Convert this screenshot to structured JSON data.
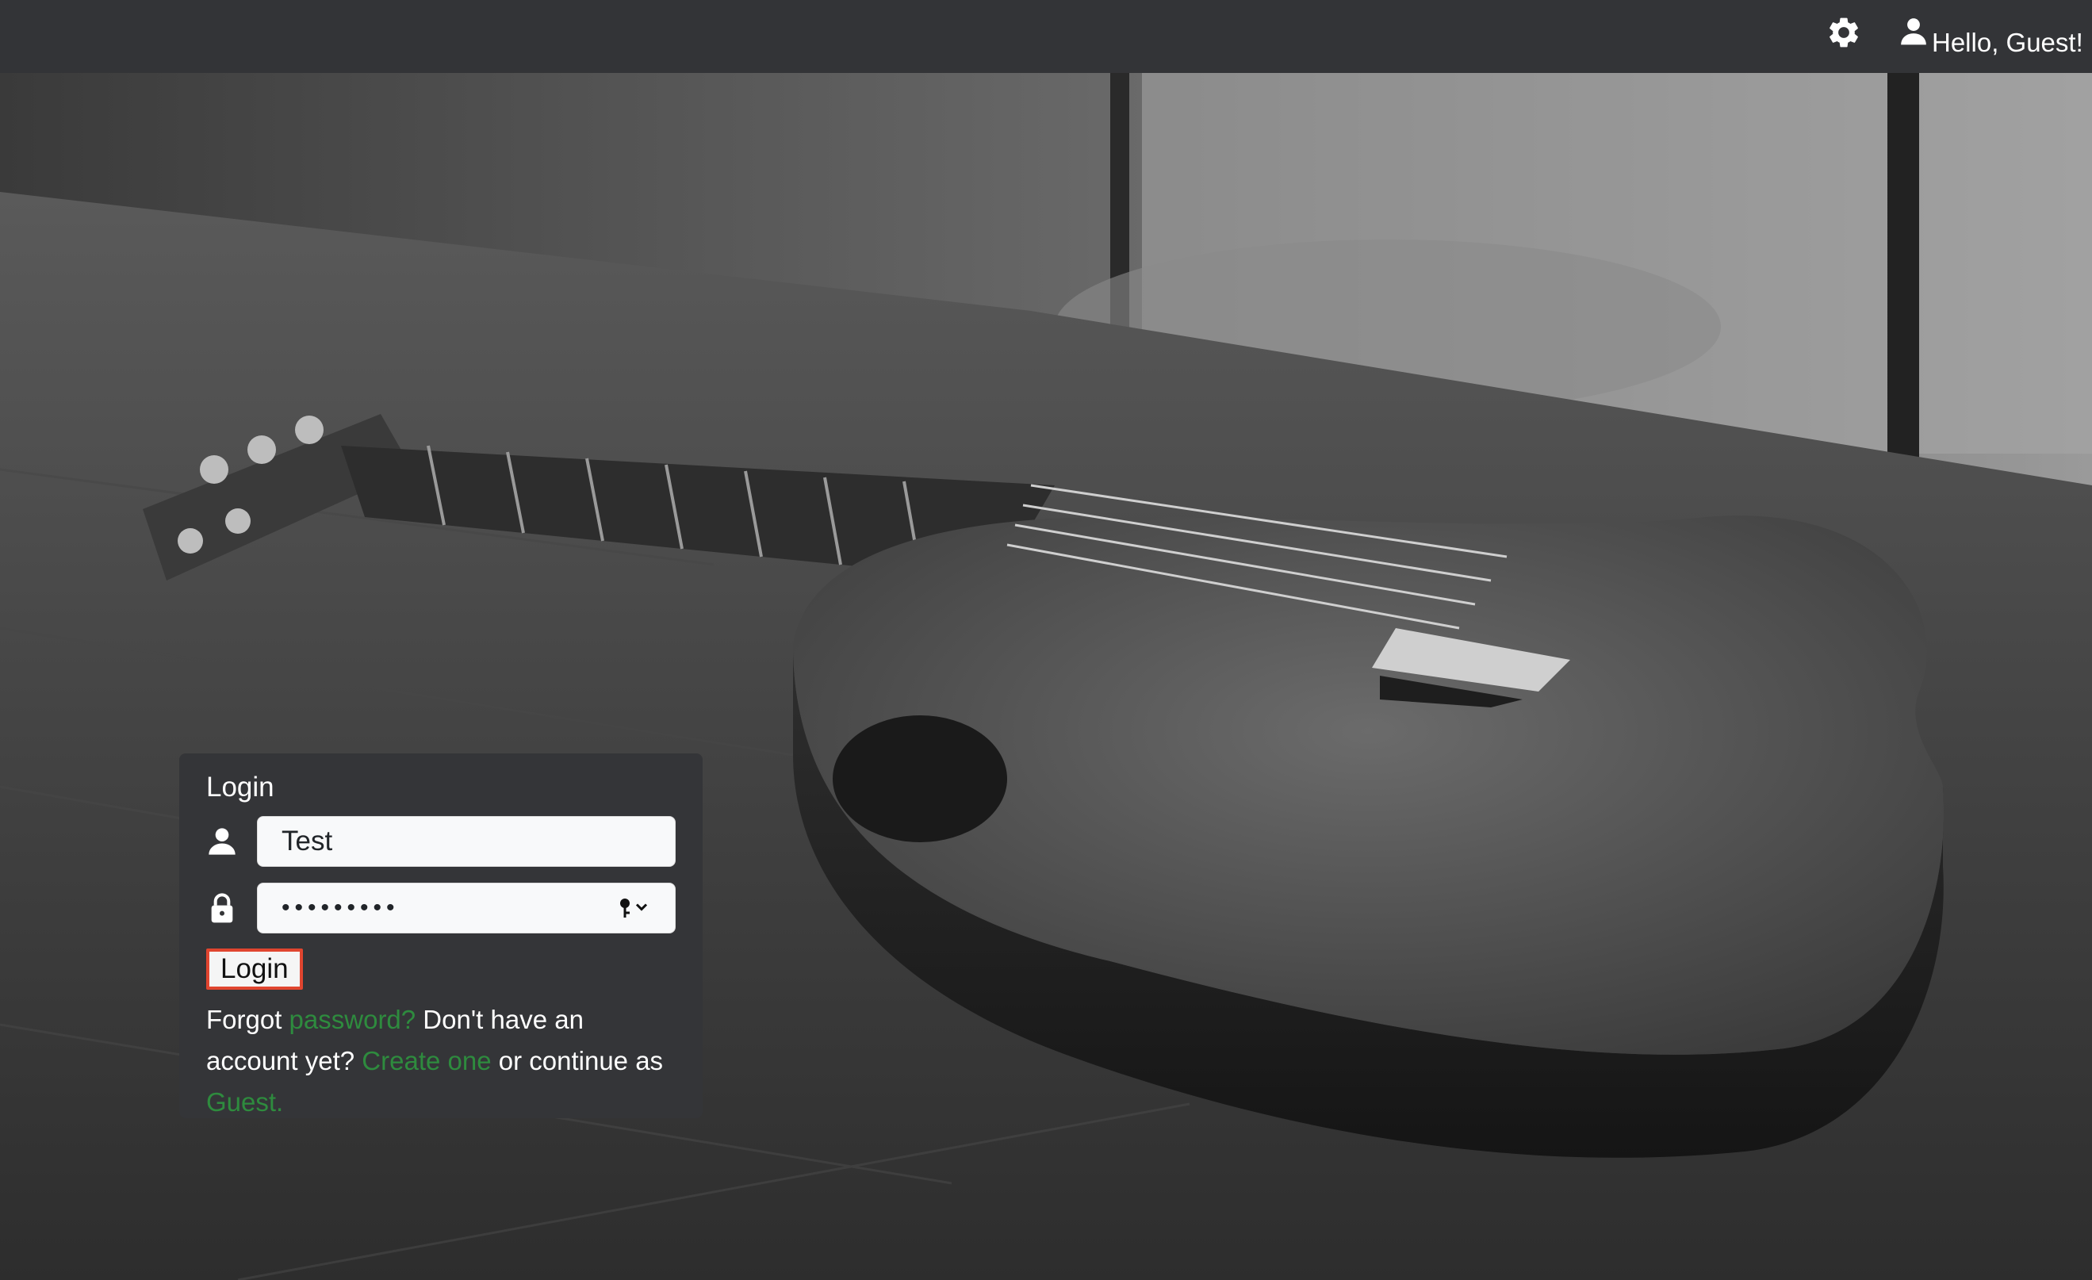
{
  "header": {
    "settings_icon": "gear-icon",
    "user_icon": "user-icon",
    "greeting": "Hello, Guest!"
  },
  "login": {
    "title": "Login",
    "username_icon": "user-icon",
    "username_value": "Test",
    "password_icon": "lock-icon",
    "password_value": "•••••••••",
    "password_manager_icon": "key-icon",
    "button_label": "Login",
    "help": {
      "t1": "Forgot ",
      "link_password": "password?",
      "t2": " Don't have an account yet? ",
      "link_create": "Create one",
      "t3": " or continue as ",
      "link_guest": "Guest."
    }
  },
  "colors": {
    "topbar": "#333437",
    "panel": "#343538",
    "link": "#2e8b3e",
    "button_border": "#e0452f"
  },
  "background": {
    "image": "ukulele-on-wooden-table-photo"
  }
}
